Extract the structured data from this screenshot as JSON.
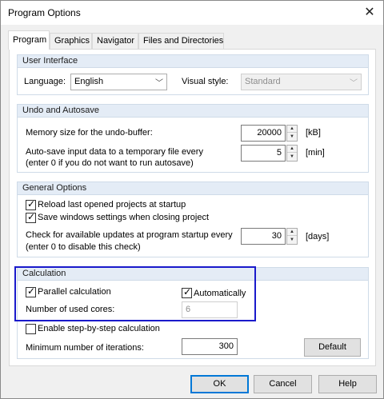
{
  "window": {
    "title": "Program Options"
  },
  "tabs": [
    "Program",
    "Graphics",
    "Navigator",
    "Files and Directories"
  ],
  "user_interface": {
    "header": "User Interface",
    "language_label": "Language:",
    "language_value": "English",
    "visual_style_label": "Visual style:",
    "visual_style_value": "Standard"
  },
  "undo_autosave": {
    "header": "Undo and Autosave",
    "memory_label": "Memory size for the undo-buffer:",
    "memory_value": "20000",
    "memory_unit": "[kB]",
    "autosave_label_1": "Auto-save input data to a temporary file every",
    "autosave_label_2": "(enter 0 if you do not want to run autosave)",
    "autosave_value": "5",
    "autosave_unit": "[min]"
  },
  "general_options": {
    "header": "General Options",
    "reload_label": "Reload last opened projects at startup",
    "reload_checked": true,
    "save_windows_label": "Save windows settings when closing project",
    "save_windows_checked": true,
    "updates_label_1": "Check for available updates at program startup every",
    "updates_label_2": "(enter 0 to disable this check)",
    "updates_value": "30",
    "updates_unit": "[days]"
  },
  "calculation": {
    "header": "Calculation",
    "parallel_label": "Parallel calculation",
    "parallel_checked": true,
    "automatically_label": "Automatically",
    "automatically_checked": true,
    "cores_label": "Number of used cores:",
    "cores_value": "6",
    "step_label": "Enable step-by-step calculation",
    "step_checked": false,
    "min_iter_label": "Minimum number of iterations:",
    "min_iter_value": "300",
    "default_button": "Default"
  },
  "buttons": {
    "ok": "OK",
    "cancel": "Cancel",
    "help": "Help"
  },
  "colors": {
    "accent": "#0078d7",
    "highlight_box": "#1a1acb",
    "group_header": "#e4ecf6"
  },
  "icons": {
    "close": "close-icon",
    "dropdown": "chevron-down-icon",
    "check": "checkmark-icon"
  }
}
